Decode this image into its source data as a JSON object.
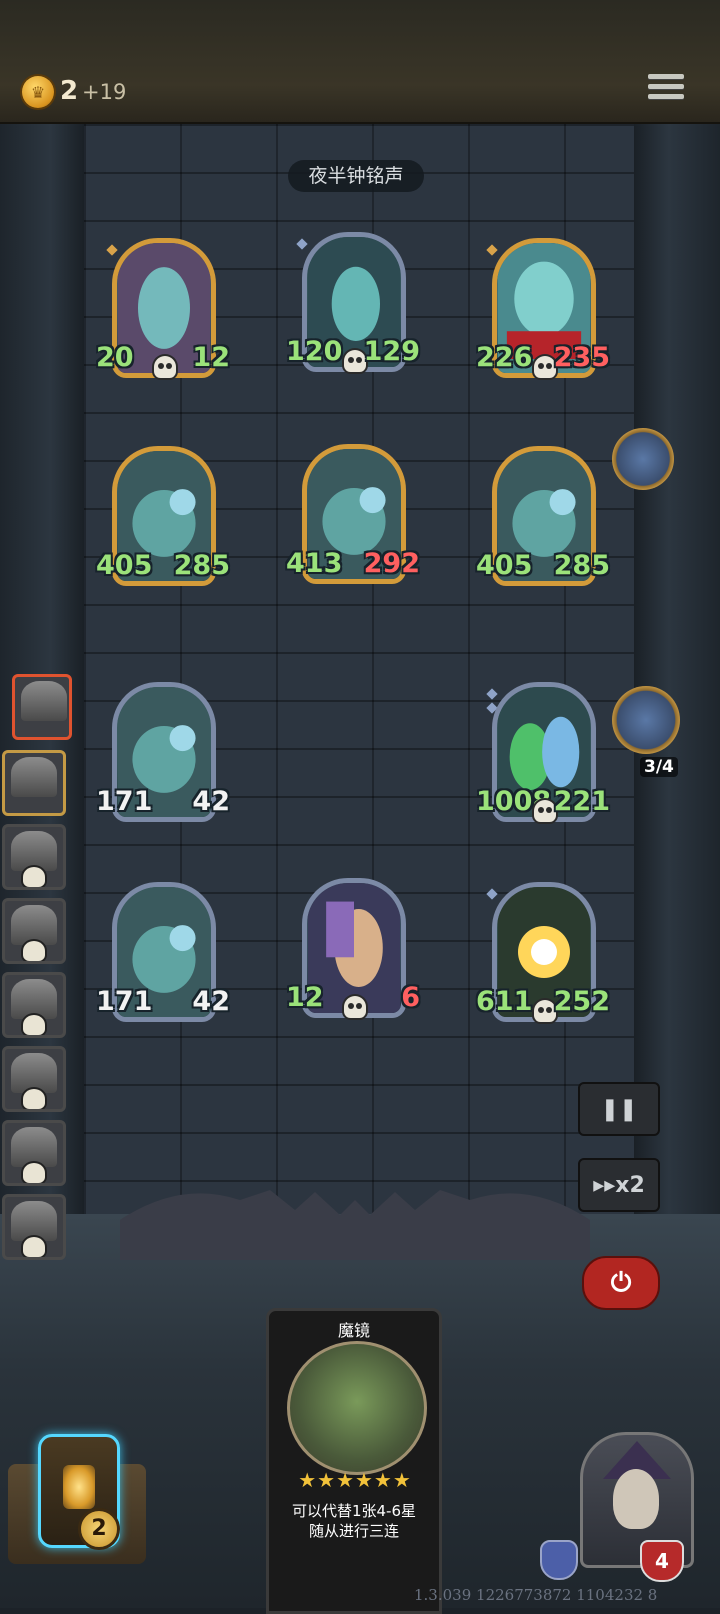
{
  "header": {
    "gold": "2",
    "gold_income": "+19",
    "icons": {
      "coin": "crown-coin-icon",
      "menu": "hamburger-menu-icon"
    }
  },
  "board_title": "夜半钟铭声",
  "enemy_minions": [
    {
      "attack": "20",
      "health": "12",
      "attack_buffed": true,
      "health_damaged": false,
      "frame": "gold"
    },
    {
      "attack": "120",
      "health": "129",
      "attack_buffed": true,
      "health_damaged": false,
      "frame": "silver"
    },
    {
      "attack": "226",
      "health": "235",
      "attack_buffed": true,
      "health_damaged": true,
      "frame": "gold"
    },
    {
      "attack": "405",
      "health": "285",
      "attack_buffed": true,
      "health_damaged": false,
      "frame": "gold"
    },
    {
      "attack": "413",
      "health": "292",
      "attack_buffed": true,
      "health_damaged": true,
      "frame": "gold"
    },
    {
      "attack": "405",
      "health": "285",
      "attack_buffed": true,
      "health_damaged": false,
      "frame": "gold"
    }
  ],
  "player_minions": [
    {
      "attack": "171",
      "health": "42",
      "attack_buffed": false,
      "health_damaged": false,
      "frame": "silver"
    },
    {
      "attack": "1008",
      "health": "221",
      "attack_buffed": true,
      "health_damaged": false,
      "frame": "silver"
    },
    {
      "attack": "171",
      "health": "42",
      "attack_buffed": false,
      "health_damaged": false,
      "frame": "silver"
    },
    {
      "attack": "12",
      "health": "6",
      "attack_buffed": true,
      "health_damaged": true,
      "frame": "silver"
    },
    {
      "attack": "611",
      "health": "252",
      "attack_buffed": true,
      "health_damaged": false,
      "frame": "silver"
    }
  ],
  "round_counter": "3/4",
  "controls": {
    "speed_label": "x2",
    "icons": {
      "pause": "pause-icon",
      "speed": "fast-forward-icon",
      "power": "power-icon"
    }
  },
  "card": {
    "name": "魔镜",
    "stars": "★★★★★★",
    "star_count": 6,
    "description_line1": "可以代替1张4-6星",
    "description_line2": "随从进行三连"
  },
  "tavern_tier": "2",
  "player_health": "4",
  "version": "1.3.039 1226773872 1104232 8",
  "colors": {
    "buffed_stat": "#9be27a",
    "damaged_stat": "#ff6060",
    "gold_frame": "#d39b3a",
    "active_border": "#e0532f",
    "power_button": "#b22621"
  }
}
